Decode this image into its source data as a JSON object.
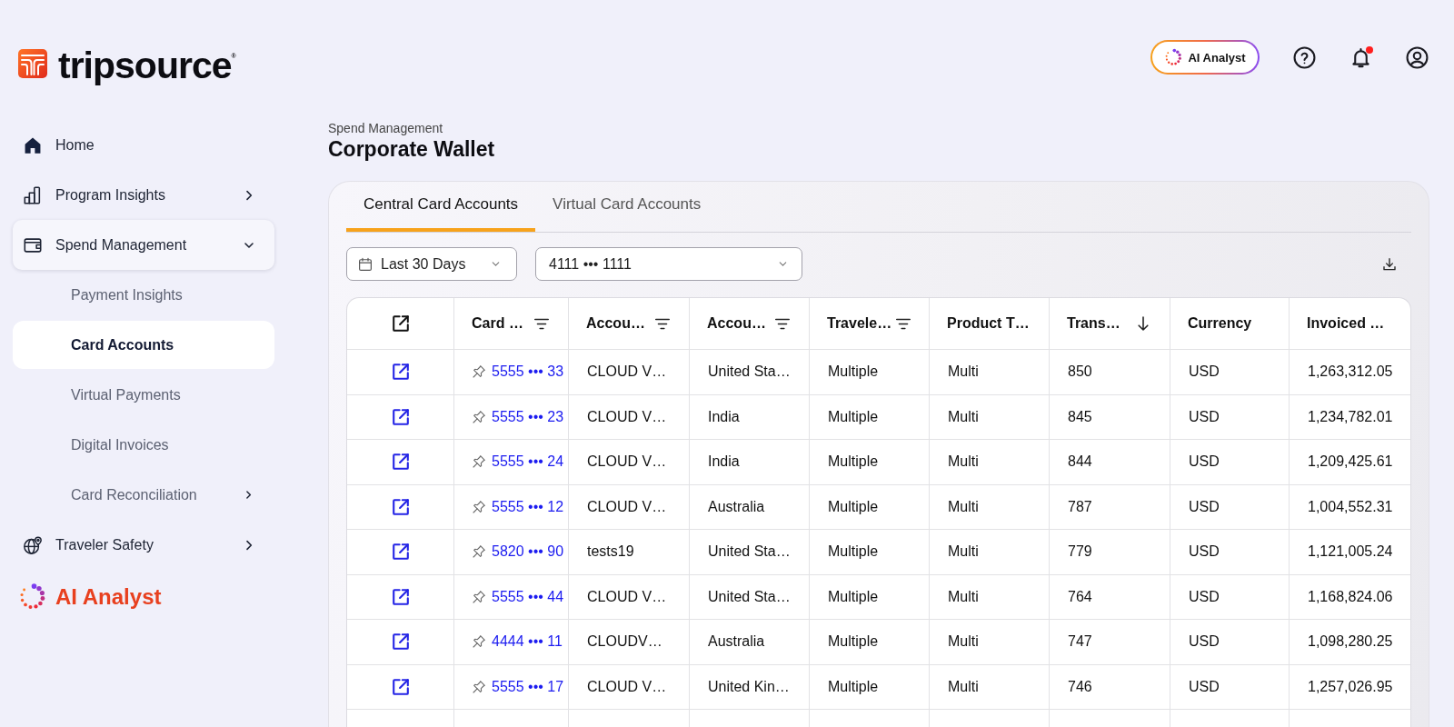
{
  "header": {
    "logo": {
      "text": "tripsource$^{®}$"
    },
    "ai_button": {
      "label": "AI Analyst"
    },
    "notifications": {
      "unread": true
    }
  },
  "sidebar": {
    "items": [
      {
        "label": "Home",
        "kind": "link",
        "selected": false
      },
      {
        "label": "Program Insights",
        "kind": "group",
        "selected": false,
        "expanded": false
      },
      {
        "label": "Spend Management",
        "kind": "group",
        "selected": true,
        "expanded": true,
        "children": [
          {
            "label": "Payment Insights",
            "kind": "link",
            "selected": false
          },
          {
            "label": "Card Accounts",
            "kind": "link",
            "selected": true
          },
          {
            "label": "Virtual Payments",
            "kind": "link",
            "selected": false
          },
          {
            "label": "Digital Invoices",
            "kind": "link",
            "selected": false
          },
          {
            "label": "Card Reconciliation",
            "kind": "group",
            "selected": false,
            "expanded": false
          }
        ]
      },
      {
        "label": "Traveler Safety",
        "kind": "group",
        "selected": false,
        "expanded": false
      }
    ],
    "ai_link": {
      "label": "AI Analyst"
    }
  },
  "page": {
    "breadcrumb": "Spend Management",
    "title": "Corporate Wallet"
  },
  "tabs": [
    {
      "label": "Central Card Accounts",
      "selected": true
    },
    {
      "label": "Virtual Card Accounts",
      "selected": false
    }
  ],
  "filters": {
    "date_range": {
      "value": "Last 30 Days"
    },
    "card": {
      "value": "4111 ••• 1111"
    }
  },
  "table": {
    "columns": [
      {
        "kind": "link",
        "label": "Card …",
        "filter": true,
        "sorted": false
      },
      {
        "kind": "text",
        "label": "Accou…",
        "filter": true,
        "sorted": false
      },
      {
        "kind": "text",
        "label": "Accou…",
        "filter": true,
        "sorted": false
      },
      {
        "kind": "text",
        "label": "Travele…",
        "filter": true,
        "sorted": false
      },
      {
        "kind": "text",
        "label": "Product T…",
        "filter": false,
        "sorted": false
      },
      {
        "kind": "text",
        "label": "Trans…",
        "filter": false,
        "sorted": true
      },
      {
        "kind": "text",
        "label": "Currency",
        "filter": false,
        "sorted": false
      },
      {
        "kind": "text",
        "label": "Invoiced …",
        "filter": false,
        "sorted": false
      }
    ],
    "rows": [
      {
        "pinned": false,
        "cells": [
          "5555 ••• 33",
          "CLOUD V…",
          "United Sta…",
          "Multiple",
          "Multi",
          "850",
          "USD",
          "1,263,312.05"
        ]
      },
      {
        "pinned": false,
        "cells": [
          "5555 ••• 23",
          "CLOUD V…",
          "India",
          "Multiple",
          "Multi",
          "845",
          "USD",
          "1,234,782.01"
        ]
      },
      {
        "pinned": false,
        "cells": [
          "5555 ••• 24",
          "CLOUD V…",
          "India",
          "Multiple",
          "Multi",
          "844",
          "USD",
          "1,209,425.61"
        ]
      },
      {
        "pinned": false,
        "cells": [
          "5555 ••• 12",
          "CLOUD V…",
          "Australia",
          "Multiple",
          "Multi",
          "787",
          "USD",
          "1,004,552.31"
        ]
      },
      {
        "pinned": false,
        "cells": [
          "5820 ••• 90",
          "tests19",
          "United Sta…",
          "Multiple",
          "Multi",
          "779",
          "USD",
          "1,121,005.24"
        ]
      },
      {
        "pinned": false,
        "cells": [
          "5555 ••• 44",
          "CLOUD V…",
          "United Sta…",
          "Multiple",
          "Multi",
          "764",
          "USD",
          "1,168,824.06"
        ]
      },
      {
        "pinned": false,
        "cells": [
          "4444 ••• 11",
          "CLOUDV…",
          "Australia",
          "Multiple",
          "Multi",
          "747",
          "USD",
          "1,098,280.25"
        ]
      },
      {
        "pinned": false,
        "cells": [
          "5555 ••• 17",
          "CLOUD V…",
          "United Kin…",
          "Multiple",
          "Multi",
          "746",
          "USD",
          "1,257,026.95"
        ]
      }
    ]
  }
}
